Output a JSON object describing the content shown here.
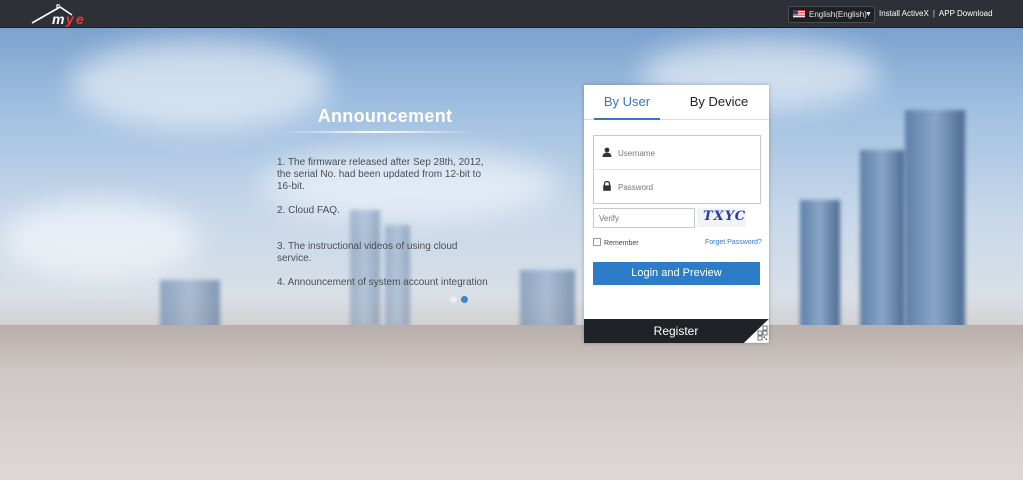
{
  "header": {
    "logo_text": "mye",
    "language": "English(English)",
    "install_activex": "Install ActiveX",
    "separator": "|",
    "app_download": "APP Download"
  },
  "announcement": {
    "title": "Announcement",
    "items": [
      "1. The firmware released after Sep 28th, 2012, the serial No. had been updated from 12-bit to 16-bit.",
      "2. Cloud FAQ.",
      "3. The instructional videos of using cloud service.",
      "4. Announcement of system account integration"
    ],
    "active_dot": 2
  },
  "login": {
    "tabs": [
      "By User",
      "By Device"
    ],
    "active_tab": "By User",
    "username_placeholder": "Username",
    "password_placeholder": "Password",
    "verify_placeholder": "Verify",
    "captcha_text": "TXYC",
    "remember_label": "Remember",
    "forgot_label": "Forget Password?",
    "login_button": "Login and Preview",
    "register_button": "Register"
  },
  "colors": {
    "accent": "#2d7cc8",
    "topbar": "#2d3036",
    "register_bg": "#1f2226"
  },
  "icons": [
    "user-icon",
    "lock-icon",
    "us-flag-icon",
    "qr-code-icon",
    "chevron-down-icon"
  ]
}
